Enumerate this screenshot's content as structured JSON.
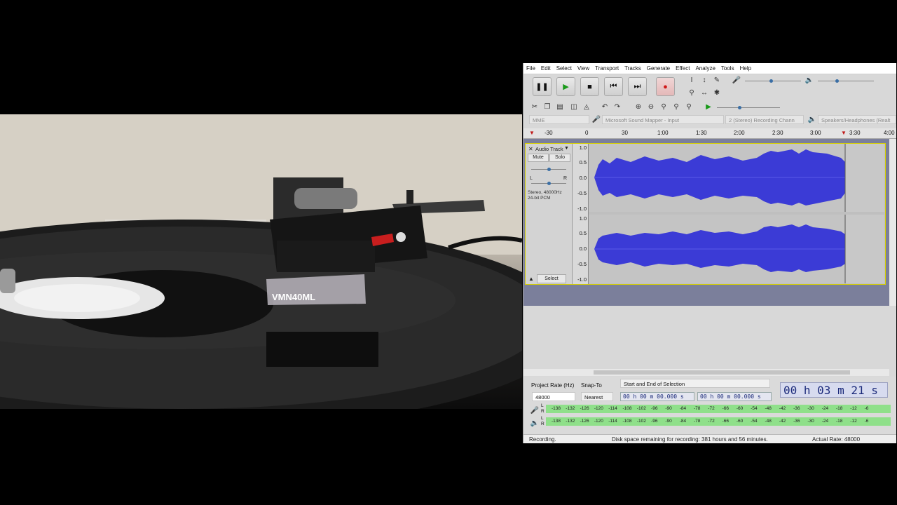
{
  "photo": {
    "cartridge_label": "VMN40ML"
  },
  "menu": [
    "File",
    "Edit",
    "Select",
    "View",
    "Transport",
    "Tracks",
    "Generate",
    "Effect",
    "Analyze",
    "Tools",
    "Help"
  ],
  "devices": {
    "host": "MME",
    "input": "Microsoft Sound Mapper - Input",
    "channels": "2 (Stereo) Recording Chann",
    "output": "Speakers/Headphones (Realt"
  },
  "ruler": [
    "-30",
    "0",
    "30",
    "1:00",
    "1:30",
    "2:00",
    "2:30",
    "3:00",
    "3:30",
    "4:00"
  ],
  "track": {
    "name": "Audio Track",
    "mute": "Mute",
    "solo": "Solo",
    "left": "L",
    "right": "R",
    "info_line1": "Stereo, 48000Hz",
    "info_line2": "24-bit PCM",
    "select": "Select",
    "scale": [
      "1.0",
      "0.5",
      "0.0",
      "-0.5",
      "-1.0"
    ]
  },
  "bottom": {
    "rate_label": "Project Rate (Hz)",
    "rate_value": "48000",
    "snap_label": "Snap-To",
    "snap_value": "Nearest",
    "selection_mode": "Start and End of Selection",
    "start_time": "00 h 00 m 00.000 s",
    "end_time": "00 h 00 m 00.000 s",
    "audio_position": "00 h 03 m 21 s"
  },
  "meter_ticks": [
    "-138",
    "-132",
    "-126",
    "-120",
    "-114",
    "-108",
    "-102",
    "-96",
    "-90",
    "-84",
    "-78",
    "-72",
    "-66",
    "-60",
    "-54",
    "-48",
    "-42",
    "-36",
    "-30",
    "-24",
    "-18",
    "-12",
    "-6"
  ],
  "meter_lr": [
    "L",
    "R"
  ],
  "status": {
    "state": "Recording.",
    "disk": "Disk space remaining for recording: 381 hours and 56 minutes.",
    "rate": "Actual Rate: 48000"
  },
  "colors": {
    "waveform": "#3b3bd6",
    "meter": "#8fe08a",
    "record": "#d01818",
    "play": "#1a9a1a"
  }
}
